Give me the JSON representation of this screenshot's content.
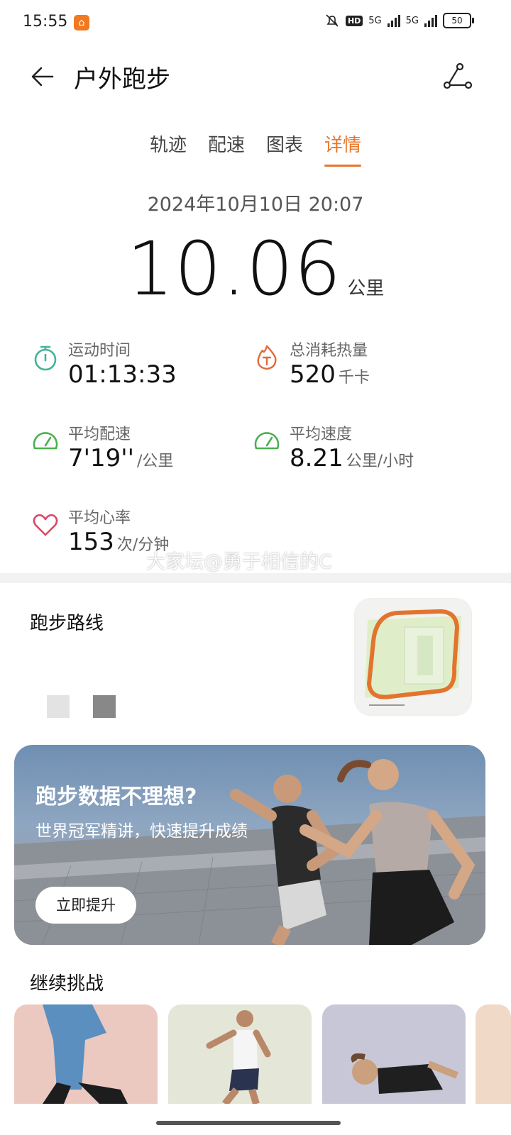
{
  "status_bar": {
    "time": "15:55",
    "app_badge": "⌂",
    "net1": "5G",
    "net2": "5G",
    "hd": "HD",
    "battery": "50"
  },
  "header": {
    "title": "户外跑步"
  },
  "tabs": [
    {
      "label": "轨迹"
    },
    {
      "label": "配速"
    },
    {
      "label": "图表"
    },
    {
      "label": "详情",
      "active": true
    }
  ],
  "summary": {
    "datetime": "2024年10月10日 20:07",
    "distance": "10.06",
    "distance_unit": "公里"
  },
  "stats": {
    "duration": {
      "label": "运动时间",
      "value": "01:13:33",
      "unit": ""
    },
    "calories": {
      "label": "总消耗热量",
      "value": "520",
      "unit": "千卡"
    },
    "avg_pace": {
      "label": "平均配速",
      "value": "7'19''",
      "unit": "/公里"
    },
    "avg_speed": {
      "label": "平均速度",
      "value": "8.21",
      "unit": "公里/小时"
    },
    "avg_hr": {
      "label": "平均心率",
      "value": "153",
      "unit": "次/分钟"
    }
  },
  "watermark": "大家坛@勇于相信的C",
  "route": {
    "title": "跑步路线"
  },
  "banner": {
    "title": "跑步数据不理想?",
    "subtitle": "世界冠军精讲，快速提升成绩",
    "button": "立即提升"
  },
  "challenge": {
    "title": "继续挑战"
  },
  "colors": {
    "accent": "#e8762d",
    "teal": "#3fb59a",
    "flame": "#e06a3a",
    "green": "#4caf50",
    "heart": "#d64a6a"
  }
}
